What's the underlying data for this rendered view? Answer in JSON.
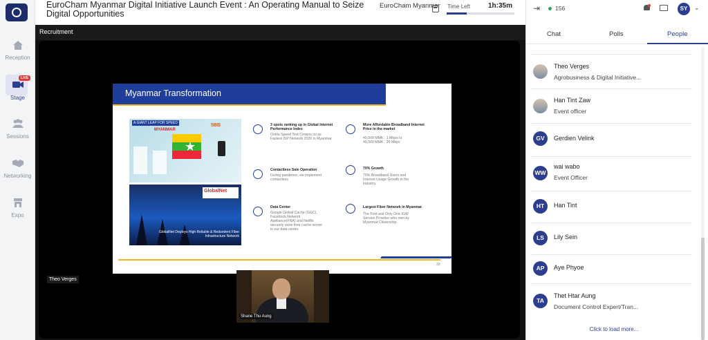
{
  "event": {
    "title": "EuroCham Myanmar Digital Initiative Launch Event : An Operating Manual to Seize Digital Opportunities",
    "org": "EuroCham Myanmar",
    "time_left_label": "Time Left",
    "time_left": "1h:35m",
    "time_progress": 0.3
  },
  "nav": {
    "items": [
      {
        "label": "Reception"
      },
      {
        "label": "Stage"
      },
      {
        "label": "Sessions"
      },
      {
        "label": "Networking"
      },
      {
        "label": "Expo"
      }
    ],
    "live_badge": "LIVE"
  },
  "stage": {
    "name": "Recruitment",
    "presenter_label": "Theo Verges",
    "camera_label": "Shane Thu Aung"
  },
  "slide": {
    "title": "Myanmar Transformation",
    "speed_tag": "A GIANT LEAP FOR SPEED",
    "map_title": "MYANMAR",
    "bb5": "5BB",
    "gn_logo": "GlobalNet",
    "gn_caption": "GlobalNet Deploys High Reliable & Redundent Fiber Infrastructure Network",
    "points": [
      {
        "head": "3 spots ranking up in Global Internet Performance Index",
        "body": "Ookla Speed Test Crowns us as Fastest ISP Network 2020 in Myanmar"
      },
      {
        "head": "More Affordable Broadband Internet Price in the market",
        "body": "49,500 MMK : 1 Mbps to 49,500 MMK : 30 Mbps"
      },
      {
        "head": "Contactless Sale Operation",
        "body": "During pandemic, we implement contactless"
      },
      {
        "head": "70% Growth",
        "body": "70% Broadband Users and Internet Usage Growth in the industry."
      },
      {
        "head": "Data Center",
        "body": "Google Global Cache (GGC), Facebook Network Appliance(FNA) and Netflix securely store their cache server in our data center."
      },
      {
        "head": "Largest Fiber Network in Myanmar",
        "body": "The First and Only One IGW Service Provider who own by Myanmar Citizenship."
      }
    ],
    "page": "33"
  },
  "panel": {
    "online_count": "156",
    "avatar_initials": "SY",
    "tabs": [
      "Chat",
      "Polls",
      "People"
    ],
    "people": [
      {
        "initials": "",
        "name": "Theo Verges",
        "sub": "Agrobusiness & Digital Initiative..."
      },
      {
        "initials": "",
        "name": "Han Tint Zaw",
        "sub": "Event officer"
      },
      {
        "initials": "GV",
        "name": "Gerdien Velink",
        "sub": ""
      },
      {
        "initials": "WW",
        "name": "wai wabo",
        "sub": "Event Officer"
      },
      {
        "initials": "HT",
        "name": "Han Tint",
        "sub": ""
      },
      {
        "initials": "LS",
        "name": "Lily Sein",
        "sub": ""
      },
      {
        "initials": "AP",
        "name": "Aye Phyoe",
        "sub": ""
      },
      {
        "initials": "TA",
        "name": "Thet Htar Aung",
        "sub": "Document Control Expert/Tran..."
      }
    ],
    "load_more": "Click to load more..."
  },
  "colors": {
    "accent": "#2c3e8f",
    "live": "#e53935",
    "online": "#2ea44f"
  }
}
